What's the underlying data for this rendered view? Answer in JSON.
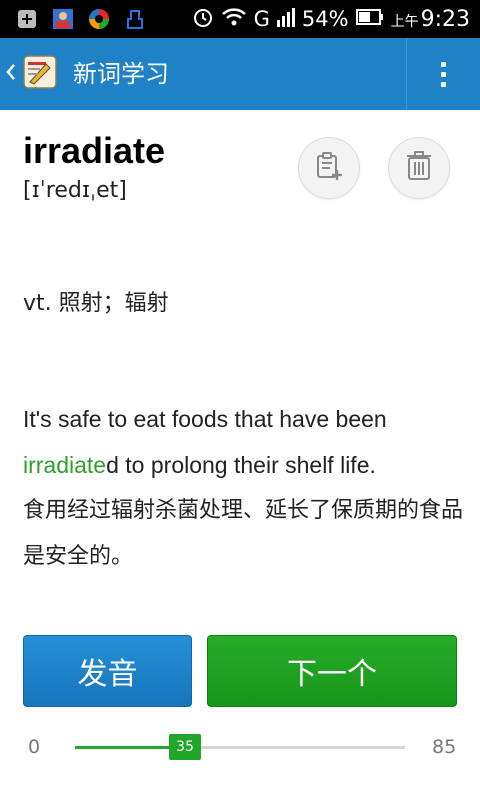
{
  "status_bar": {
    "battery": "54%",
    "network": "G",
    "time_prefix": "上午",
    "time": "9:23",
    "icons": [
      "plus-square-icon",
      "contacts-icon",
      "app-icon",
      "usb-icon",
      "alarm-icon",
      "wifi-icon",
      "signal-icon",
      "battery-icon"
    ]
  },
  "header": {
    "title": "新词学习",
    "app_icon": "notebook-app-icon"
  },
  "word": {
    "text": "irradiate",
    "phonetic": "[ɪˈredɪˌet]"
  },
  "actions": {
    "add_icon": "add-to-list-icon",
    "delete_icon": "trash-icon"
  },
  "definition": "vt. 照射；辐射",
  "example": {
    "before": "It's safe to eat foods that have been ",
    "highlight": "irradiate",
    "after": "d to prolong their shelf life.",
    "translation": "食用经过辐射杀菌处理、延长了保质期的食品是安全的。"
  },
  "buttons": {
    "pronounce": "发音",
    "next": "下一个"
  },
  "progress": {
    "min": "0",
    "max": "85",
    "current": "35",
    "value": 35,
    "total": 85
  },
  "colors": {
    "actionbar": "#1f82c7",
    "highlight": "#2ea12e",
    "pronounce_button": "#1f82c7",
    "next_button": "#21a629"
  }
}
